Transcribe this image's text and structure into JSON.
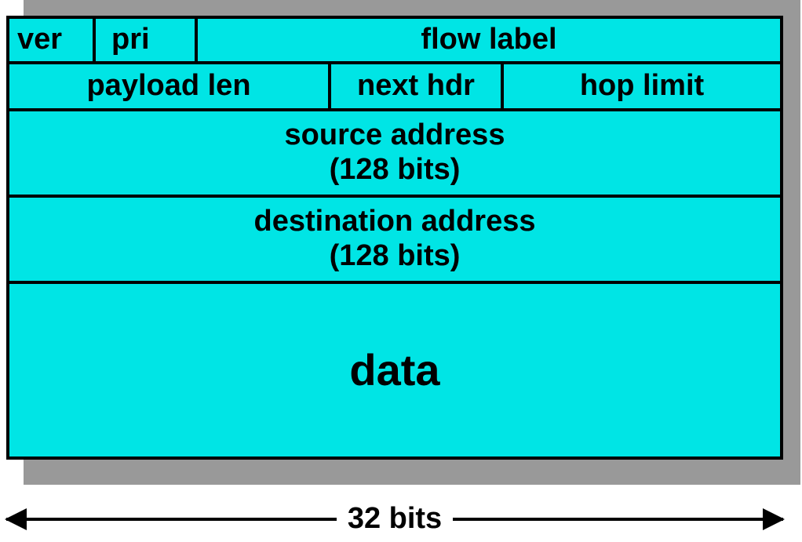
{
  "header": {
    "row1": {
      "ver": "ver",
      "pri": "pri",
      "flow_label": "flow label"
    },
    "row2": {
      "payload_len": "payload len",
      "next_hdr": "next hdr",
      "hop_limit": "hop limit"
    },
    "source_address": {
      "line1": "source address",
      "line2": "(128 bits)"
    },
    "destination_address": {
      "line1": "destination address",
      "line2": "(128 bits)"
    },
    "data": "data"
  },
  "width_label": "32 bits"
}
